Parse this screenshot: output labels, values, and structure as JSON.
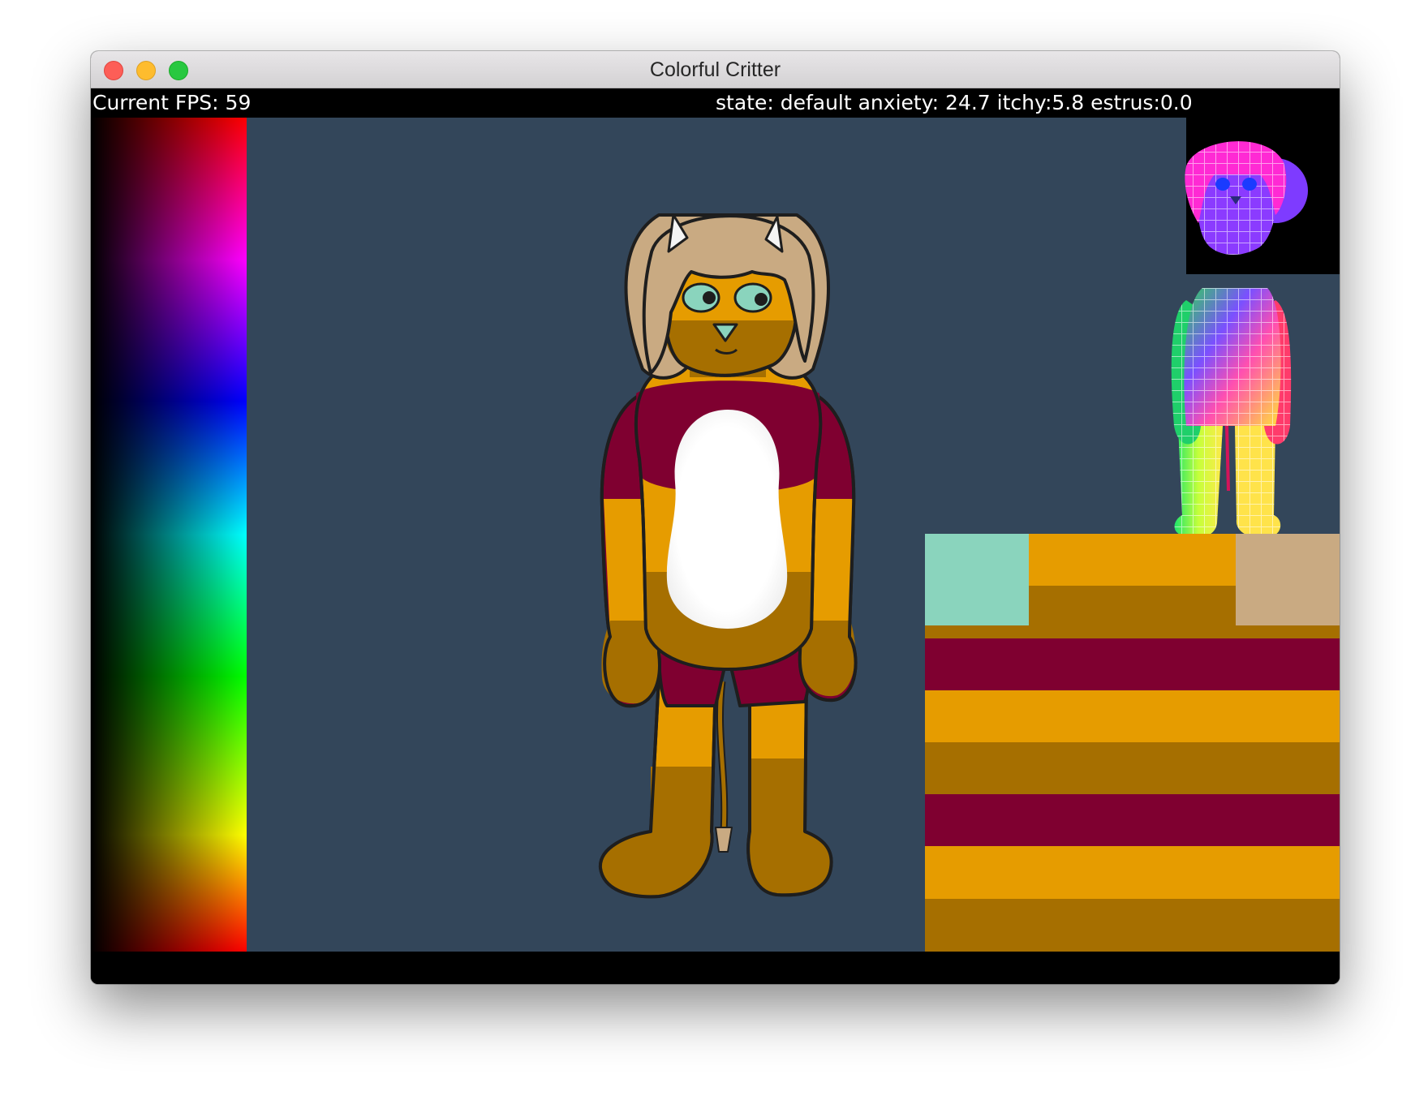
{
  "window": {
    "title": "Colorful Critter",
    "buttons": [
      "close",
      "minimize",
      "zoom"
    ]
  },
  "hud": {
    "fps": "Current FPS: 59",
    "state": "state: default anxiety: 24.7 itchy:5.8 estrus:0.0"
  },
  "colors": {
    "background": "#33465a",
    "fur_orange": "#e69c00",
    "fur_brown": "#a66f00",
    "fur_maroon": "#7f0030",
    "belly": "#ffffff",
    "eyes_nose": "#8ad4bd",
    "hair": "#c9aa82"
  },
  "icons": {
    "palette": "hue-palette-gradient",
    "debug_preview": "uv-debug-critter-preview",
    "texture_atlas": "texture-stripe-atlas",
    "critter": "critter-character"
  }
}
